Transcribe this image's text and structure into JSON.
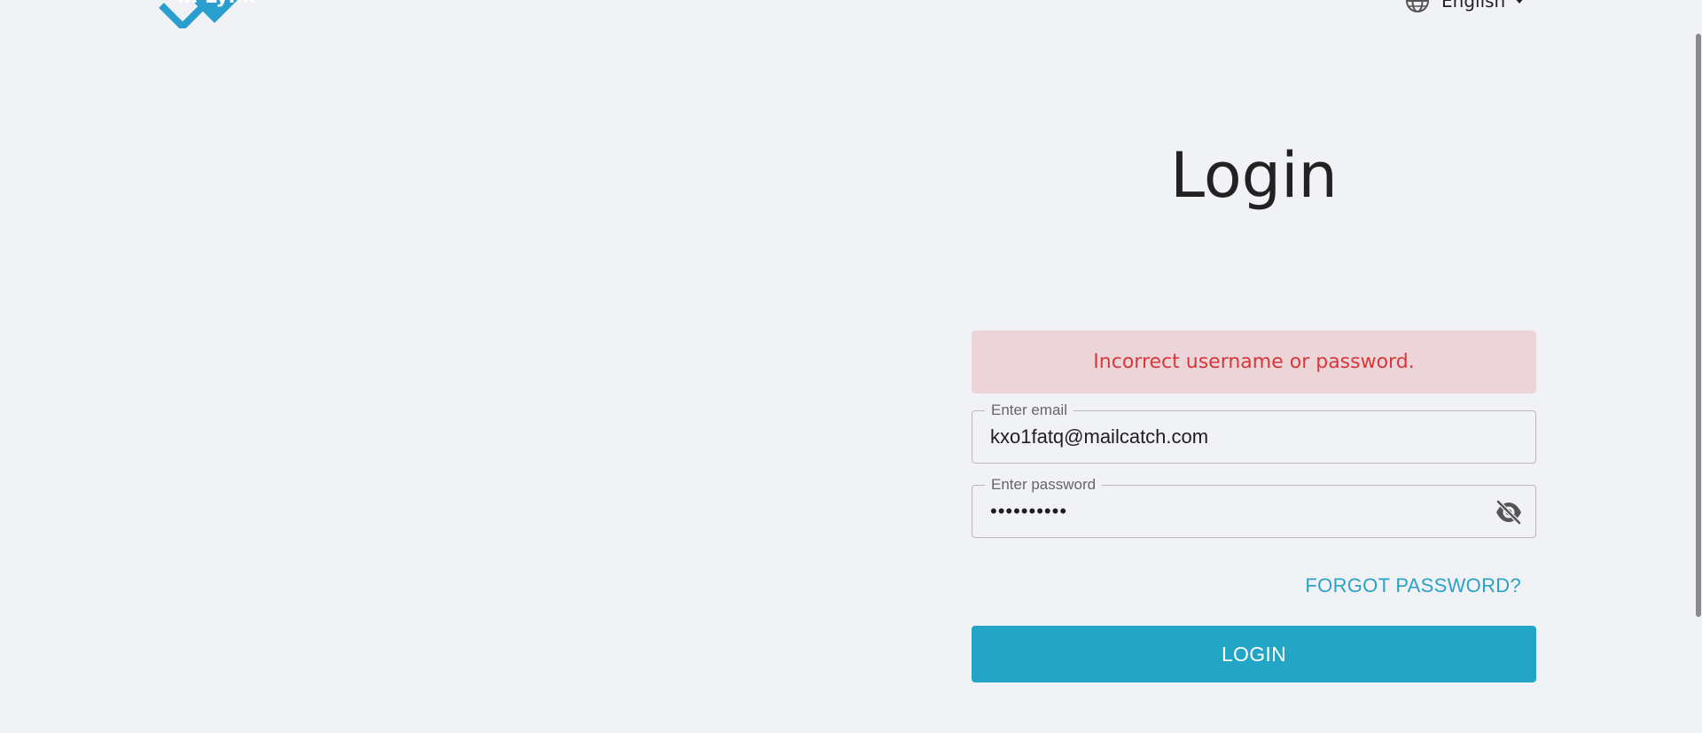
{
  "header": {
    "logo_text": "in Lynk",
    "language": {
      "label": "English",
      "icon": "globe-icon",
      "dropdown_icon": "caret-down-icon"
    }
  },
  "login": {
    "title": "Login",
    "error_message": "Incorrect username or password.",
    "email": {
      "legend": "Enter email",
      "value": "kxo1fatq@mailcatch.com"
    },
    "password": {
      "legend": "Enter password",
      "value": "••••••••••",
      "toggle_icon": "eye-off-icon"
    },
    "forgot_password": "FORGOT PASSWORD?",
    "login_button": "LOGIN"
  },
  "colors": {
    "background": "#f0f2f5",
    "accent": "#23a5c6",
    "error_text": "#d9383a",
    "error_background": "#ecd5d8"
  }
}
